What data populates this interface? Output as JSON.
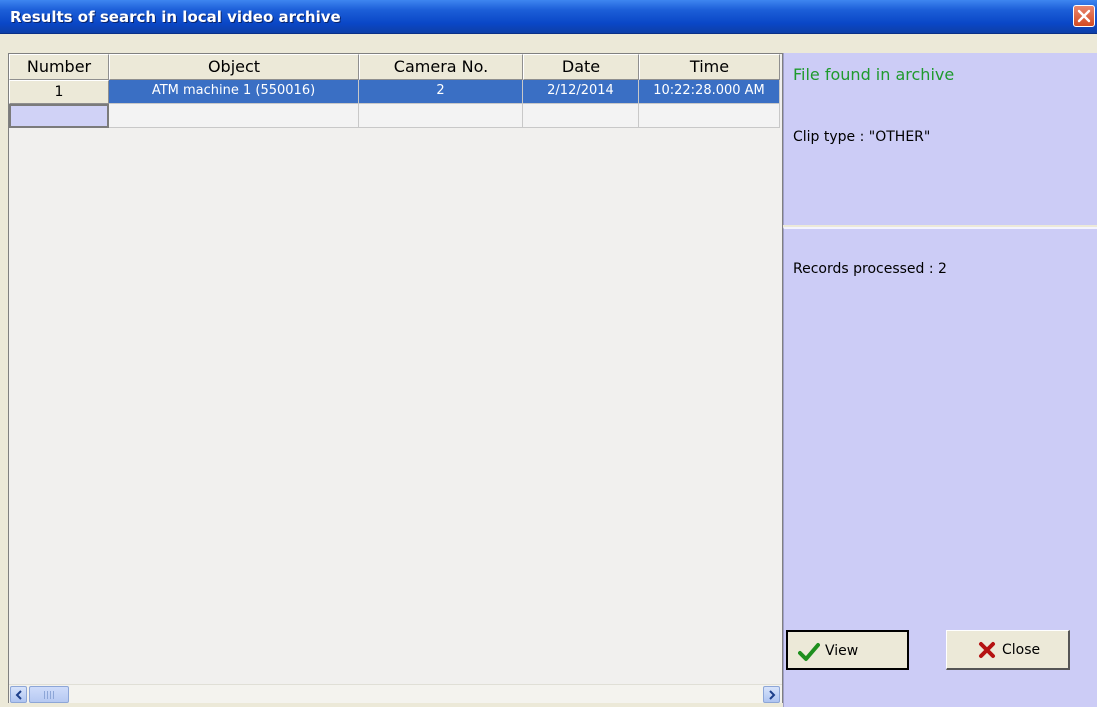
{
  "window": {
    "title": "Results of search in local video archive"
  },
  "table": {
    "columns": [
      "Number",
      "Object",
      "Camera No.",
      "Date",
      "Time"
    ],
    "rows": [
      {
        "number": "1",
        "object": "ATM machine 1 (550016)",
        "camera": "2",
        "date": "2/12/2014",
        "time": "10:22:28.000 AM"
      }
    ]
  },
  "info": {
    "status": "File found in archive",
    "clip_type": "Clip type : \"OTHER\"",
    "records": "Records processed : 2"
  },
  "buttons": {
    "view": "View",
    "close": "Close"
  },
  "colors": {
    "title_bar": "#0a47c7",
    "selection": "#3a6fc4",
    "panel": "#ccccf6",
    "status_green": "#1f9a2d"
  }
}
